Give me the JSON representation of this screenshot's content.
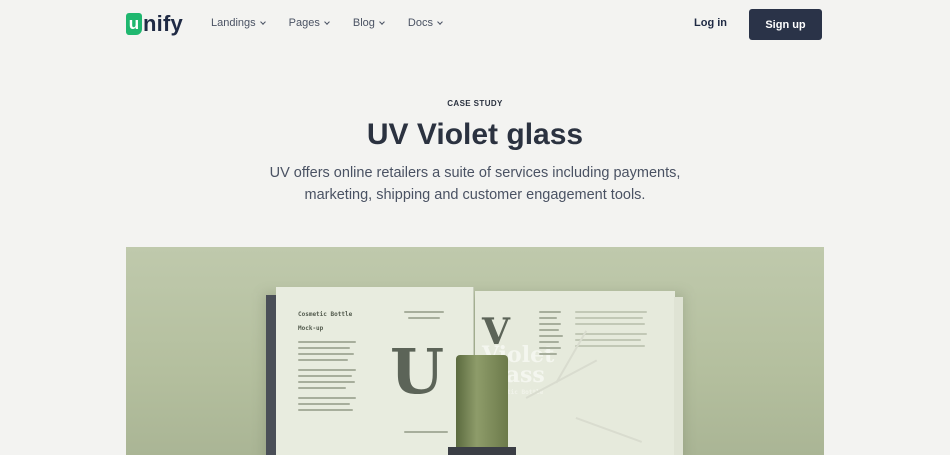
{
  "header": {
    "logo_badge": "u",
    "logo_text": "nify",
    "nav": [
      {
        "label": "Landings"
      },
      {
        "label": "Pages"
      },
      {
        "label": "Blog"
      },
      {
        "label": "Docs"
      }
    ],
    "login_label": "Log in",
    "signup_label": "Sign up"
  },
  "hero": {
    "eyebrow": "CASE STUDY",
    "title": "UV Violet glass",
    "subtitle": "UV offers online retailers a suite of services including payments, marketing, shipping and customer engagement tools."
  },
  "image": {
    "left_page_heading": "Cosmetic Bottle",
    "left_page_subheading": "Mock-up",
    "right_page_title": "Violet glass",
    "right_page_letter": "V",
    "left_page_letter": "U",
    "bottle_caption": "Cosmetic Bottle"
  },
  "colors": {
    "brand": "#1fb76f",
    "signup_bg": "#2a3348",
    "page_bg": "#f3f3f1",
    "image_bg": "#b4bf9e"
  }
}
